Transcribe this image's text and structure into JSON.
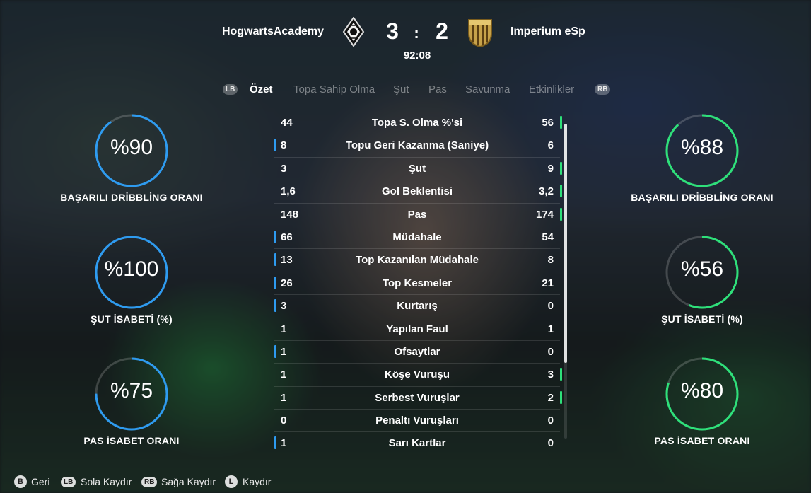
{
  "match": {
    "home_team": "HogwartsAcademy",
    "away_team": "Imperium eSp",
    "home_score": "3",
    "separator": ":",
    "away_score": "2",
    "clock": "92:08"
  },
  "tabs": {
    "lb": "LB",
    "rb": "RB",
    "items": [
      "Özet",
      "Topa Sahip Olma",
      "Şut",
      "Pas",
      "Savunma",
      "Etkinlikler"
    ],
    "active": "Özet"
  },
  "stats": [
    {
      "home": "44",
      "label": "Topa S. Olma %'si",
      "away": "56",
      "leader": "away"
    },
    {
      "home": "8",
      "label": "Topu Geri Kazanma (Saniye)",
      "away": "6",
      "leader": "home"
    },
    {
      "home": "3",
      "label": "Şut",
      "away": "9",
      "leader": "away"
    },
    {
      "home": "1,6",
      "label": "Gol Beklentisi",
      "away": "3,2",
      "leader": "away"
    },
    {
      "home": "148",
      "label": "Pas",
      "away": "174",
      "leader": "away"
    },
    {
      "home": "66",
      "label": "Müdahale",
      "away": "54",
      "leader": "home"
    },
    {
      "home": "13",
      "label": "Top Kazanılan Müdahale",
      "away": "8",
      "leader": "home"
    },
    {
      "home": "26",
      "label": "Top Kesmeler",
      "away": "21",
      "leader": "home"
    },
    {
      "home": "3",
      "label": "Kurtarış",
      "away": "0",
      "leader": "home"
    },
    {
      "home": "1",
      "label": "Yapılan Faul",
      "away": "1",
      "leader": "none"
    },
    {
      "home": "1",
      "label": "Ofsaytlar",
      "away": "0",
      "leader": "home"
    },
    {
      "home": "1",
      "label": "Köşe Vuruşu",
      "away": "3",
      "leader": "away"
    },
    {
      "home": "1",
      "label": "Serbest Vuruşlar",
      "away": "2",
      "leader": "away"
    },
    {
      "home": "0",
      "label": "Penaltı Vuruşları",
      "away": "0",
      "leader": "none"
    },
    {
      "home": "1",
      "label": "Sarı Kartlar",
      "away": "0",
      "leader": "home"
    }
  ],
  "home_side": [
    {
      "value": "%90",
      "percent": 90,
      "label": "BAŞARILI DRİBBLİNG ORANI"
    },
    {
      "value": "%100",
      "percent": 100,
      "label": "ŞUT İSABETİ (%)"
    },
    {
      "value": "%75",
      "percent": 75,
      "label": "PAS İSABET ORANI"
    }
  ],
  "away_side": [
    {
      "value": "%88",
      "percent": 88,
      "label": "BAŞARILI DRİBBLİNG ORANI"
    },
    {
      "value": "%56",
      "percent": 56,
      "label": "ŞUT İSABETİ (%)"
    },
    {
      "value": "%80",
      "percent": 80,
      "label": "PAS İSABET ORANI"
    }
  ],
  "footer": {
    "back_key": "B",
    "back": "Geri",
    "left_key": "LB",
    "left": "Sola Kaydır",
    "right_key": "RB",
    "right": "Sağa Kaydır",
    "scroll_key": "L",
    "scroll": "Kaydır"
  },
  "colors": {
    "home_accent": "#2e9bf0",
    "away_accent": "#2ee07a"
  }
}
